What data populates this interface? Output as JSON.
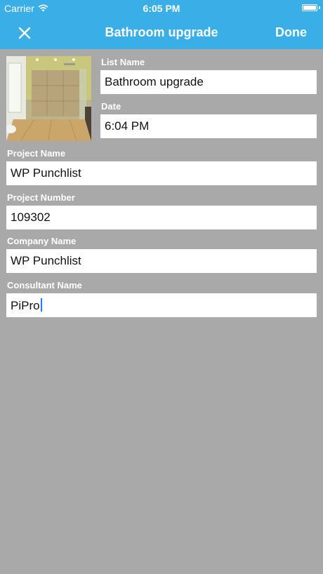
{
  "status_bar": {
    "carrier": "Carrier",
    "time": "6:05 PM",
    "icons": [
      "wifi-icon",
      "battery-icon"
    ]
  },
  "nav": {
    "title": "Bathroom upgrade",
    "close_icon": "close-icon",
    "done_label": "Done"
  },
  "photo": {
    "subject": "bathroom-photo"
  },
  "form": {
    "list_name": {
      "label": "List Name",
      "value": "Bathroom upgrade"
    },
    "date": {
      "label": "Date",
      "value": "6:04 PM"
    },
    "project_name": {
      "label": "Project Name",
      "value": "WP Punchlist"
    },
    "project_number": {
      "label": "Project Number",
      "value": "109302"
    },
    "company_name": {
      "label": "Company Name",
      "value": "WP Punchlist"
    },
    "consultant_name": {
      "label": "Consultant Name",
      "value": "PiPro"
    }
  },
  "colors": {
    "accent": "#3aaee7",
    "background": "#a9a9a9",
    "field": "#ffffff",
    "cursor": "#1f7bff"
  }
}
